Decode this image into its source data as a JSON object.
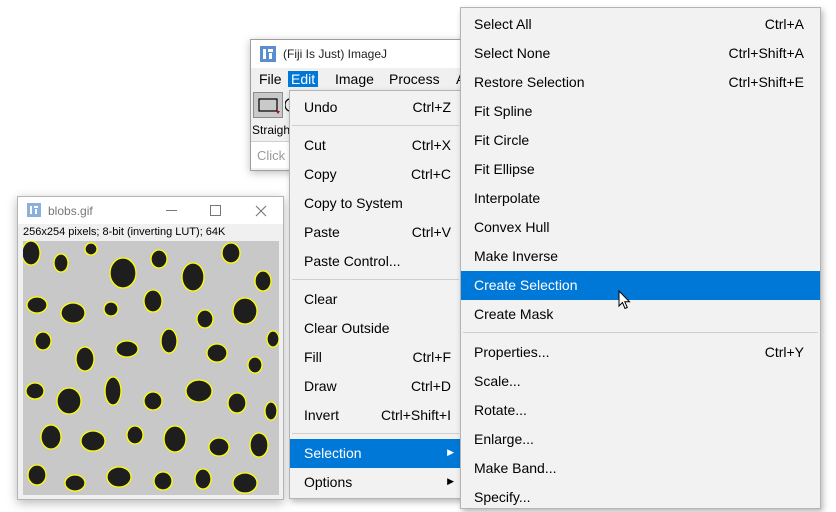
{
  "ij_window": {
    "title": "(Fiji Is Just) ImageJ",
    "menubar": [
      "File",
      "Edit",
      "Image",
      "Process",
      "A"
    ],
    "active_menu_index": 1,
    "status_line": "Straigh",
    "hint_text": "Click"
  },
  "blobs_window": {
    "title": "blobs.gif",
    "info": "256x254 pixels; 8-bit (inverting LUT); 64K"
  },
  "edit_menu": {
    "items": [
      {
        "label": "Undo",
        "shortcut": "Ctrl+Z"
      },
      {
        "label": "Cut",
        "shortcut": "Ctrl+X"
      },
      {
        "label": "Copy",
        "shortcut": "Ctrl+C"
      },
      {
        "label": "Copy to System",
        "shortcut": ""
      },
      {
        "label": "Paste",
        "shortcut": "Ctrl+V"
      },
      {
        "label": "Paste Control...",
        "shortcut": ""
      },
      {
        "label": "Clear",
        "shortcut": ""
      },
      {
        "label": "Clear Outside",
        "shortcut": ""
      },
      {
        "label": "Fill",
        "shortcut": "Ctrl+F"
      },
      {
        "label": "Draw",
        "shortcut": "Ctrl+D"
      },
      {
        "label": "Invert",
        "shortcut": "Ctrl+Shift+I"
      },
      {
        "label": "Selection",
        "shortcut": ""
      },
      {
        "label": "Options",
        "shortcut": ""
      }
    ]
  },
  "selection_menu": {
    "items": [
      {
        "label": "Select All",
        "shortcut": "Ctrl+A"
      },
      {
        "label": "Select None",
        "shortcut": "Ctrl+Shift+A"
      },
      {
        "label": "Restore Selection",
        "shortcut": "Ctrl+Shift+E"
      },
      {
        "label": "Fit Spline",
        "shortcut": ""
      },
      {
        "label": "Fit Circle",
        "shortcut": ""
      },
      {
        "label": "Fit Ellipse",
        "shortcut": ""
      },
      {
        "label": "Interpolate",
        "shortcut": ""
      },
      {
        "label": "Convex Hull",
        "shortcut": ""
      },
      {
        "label": "Make Inverse",
        "shortcut": ""
      },
      {
        "label": "Create Selection",
        "shortcut": ""
      },
      {
        "label": "Create Mask",
        "shortcut": ""
      },
      {
        "label": "Properties...",
        "shortcut": "Ctrl+Y"
      },
      {
        "label": "Scale...",
        "shortcut": ""
      },
      {
        "label": "Rotate...",
        "shortcut": ""
      },
      {
        "label": "Enlarge...",
        "shortcut": ""
      },
      {
        "label": "Make Band...",
        "shortcut": ""
      },
      {
        "label": "Specify...",
        "shortcut": ""
      }
    ]
  },
  "colors": {
    "highlight": "#0078d7",
    "selection_outline": "#ffff00"
  },
  "icons": [
    "fiji-icon",
    "rectangle-tool-icon",
    "minimize-icon",
    "maximize-icon",
    "close-icon",
    "submenu-arrow-icon",
    "mouse-cursor-icon"
  ]
}
